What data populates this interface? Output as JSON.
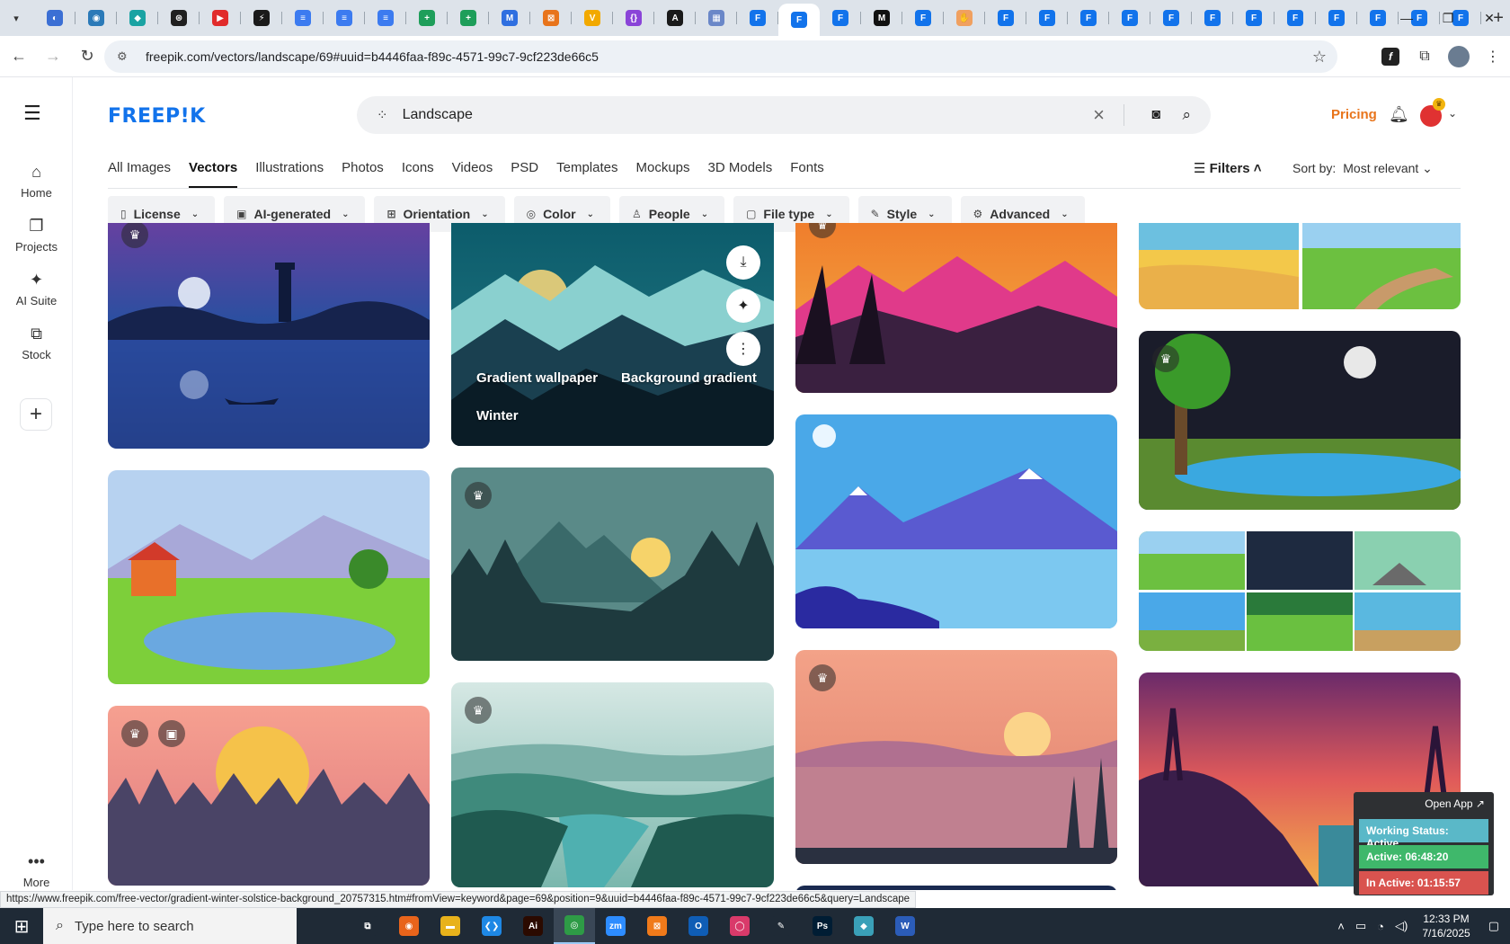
{
  "browser": {
    "tabs": [
      {
        "icon": "tab-icon-app",
        "color": "#3b6fd4",
        "glyph": "◐"
      },
      {
        "icon": "tab-icon-shield",
        "color": "#2b7ab8",
        "glyph": "◉"
      },
      {
        "icon": "tab-icon-diamond",
        "color": "#1aa3a3",
        "glyph": "◆"
      },
      {
        "icon": "tab-icon-ai",
        "color": "#202020",
        "glyph": "⊛"
      },
      {
        "icon": "tab-icon-youtube",
        "color": "#e12b2b",
        "glyph": "▶"
      },
      {
        "icon": "tab-icon-bolt",
        "color": "#1a1a1a",
        "glyph": "⚡"
      },
      {
        "icon": "tab-icon-docs",
        "color": "#3c7bf0",
        "glyph": "≡"
      },
      {
        "icon": "tab-icon-docs",
        "color": "#3c7bf0",
        "glyph": "≡"
      },
      {
        "icon": "tab-icon-docs",
        "color": "#3c7bf0",
        "glyph": "≡"
      },
      {
        "icon": "tab-icon-sheets",
        "color": "#1e9e5a",
        "glyph": "+"
      },
      {
        "icon": "tab-icon-sheets",
        "color": "#1e9e5a",
        "glyph": "+"
      },
      {
        "icon": "tab-icon-m",
        "color": "#2f6fe0",
        "glyph": "M"
      },
      {
        "icon": "tab-icon-box",
        "color": "#e8741b",
        "glyph": "⊠"
      },
      {
        "icon": "tab-icon-v",
        "color": "#f2a900",
        "glyph": "V"
      },
      {
        "icon": "tab-icon-braces",
        "color": "#8a44d8",
        "glyph": "{}"
      },
      {
        "icon": "tab-icon-a",
        "color": "#1a1a1a",
        "glyph": "A"
      },
      {
        "icon": "tab-icon-grid",
        "color": "#6a87c8",
        "glyph": "▦"
      },
      {
        "icon": "tab-icon-freepik",
        "color": "#1273eb",
        "glyph": "F"
      },
      {
        "icon": "tab-icon-freepik",
        "color": "#1273eb",
        "glyph": "F",
        "active": true
      },
      {
        "icon": "tab-icon-freepik",
        "color": "#1273eb",
        "glyph": "F"
      },
      {
        "icon": "tab-icon-m-black",
        "color": "#111111",
        "glyph": "M"
      },
      {
        "icon": "tab-icon-freepik",
        "color": "#1273eb",
        "glyph": "F"
      },
      {
        "icon": "tab-icon-hand",
        "color": "#f0a060",
        "glyph": "✋"
      },
      {
        "icon": "tab-icon-freepik",
        "color": "#1273eb",
        "glyph": "F"
      },
      {
        "icon": "tab-icon-freepik",
        "color": "#1273eb",
        "glyph": "F"
      },
      {
        "icon": "tab-icon-freepik",
        "color": "#1273eb",
        "glyph": "F"
      },
      {
        "icon": "tab-icon-freepik",
        "color": "#1273eb",
        "glyph": "F"
      },
      {
        "icon": "tab-icon-freepik",
        "color": "#1273eb",
        "glyph": "F"
      },
      {
        "icon": "tab-icon-freepik",
        "color": "#1273eb",
        "glyph": "F"
      },
      {
        "icon": "tab-icon-freepik",
        "color": "#1273eb",
        "glyph": "F"
      },
      {
        "icon": "tab-icon-freepik",
        "color": "#1273eb",
        "glyph": "F"
      },
      {
        "icon": "tab-icon-freepik",
        "color": "#1273eb",
        "glyph": "F"
      },
      {
        "icon": "tab-icon-freepik",
        "color": "#1273eb",
        "glyph": "F"
      },
      {
        "icon": "tab-icon-freepik",
        "color": "#1273eb",
        "glyph": "F"
      },
      {
        "icon": "tab-icon-freepik",
        "color": "#1273eb",
        "glyph": "F"
      }
    ],
    "url": "freepik.com/vectors/landscape/69#uuid=b4446faa-f89c-4571-99c7-9cf223de66c5",
    "status_link": "https://www.freepik.com/free-vector/gradient-winter-solstice-background_20757315.htm#fromView=keyword&page=69&position=9&uuid=b4446faa-f89c-4571-99c7-9cf223de66c5&query=Landscape"
  },
  "rail": {
    "items": [
      {
        "label": "Home",
        "icon": "home-icon",
        "glyph": "⌂"
      },
      {
        "label": "Projects",
        "icon": "projects-icon",
        "glyph": "❐"
      },
      {
        "label": "AI Suite",
        "icon": "ai-suite-icon",
        "glyph": "✦"
      },
      {
        "label": "Stock",
        "icon": "stock-icon",
        "glyph": "⧉"
      }
    ],
    "more_label": "More"
  },
  "header": {
    "logo": "FREEP!K",
    "search_query": "Landscape",
    "pricing": "Pricing"
  },
  "categories": [
    {
      "label": "All Images",
      "active": false
    },
    {
      "label": "Vectors",
      "active": true
    },
    {
      "label": "Illustrations",
      "active": false
    },
    {
      "label": "Photos",
      "active": false
    },
    {
      "label": "Icons",
      "active": false
    },
    {
      "label": "Videos",
      "active": false
    },
    {
      "label": "PSD",
      "active": false
    },
    {
      "label": "Templates",
      "active": false
    },
    {
      "label": "Mockups",
      "active": false
    },
    {
      "label": "3D Models",
      "active": false
    },
    {
      "label": "Fonts",
      "active": false
    }
  ],
  "sort": {
    "filters_label": "Filters",
    "sort_label": "Sort by:",
    "sort_value": "Most relevant"
  },
  "chips": [
    {
      "label": "License",
      "icon": "license-icon",
      "glyph": "▯"
    },
    {
      "label": "AI-generated",
      "icon": "ai-generated-icon",
      "glyph": "▣"
    },
    {
      "label": "Orientation",
      "icon": "orientation-icon",
      "glyph": "⊞"
    },
    {
      "label": "Color",
      "icon": "palette-icon",
      "glyph": "◎"
    },
    {
      "label": "People",
      "icon": "people-icon",
      "glyph": "♙"
    },
    {
      "label": "File type",
      "icon": "file-icon",
      "glyph": "▢"
    },
    {
      "label": "Style",
      "icon": "brush-icon",
      "glyph": "✎"
    },
    {
      "label": "Advanced",
      "icon": "gear-icon",
      "glyph": "⚙"
    }
  ],
  "hovered_card": {
    "tags": [
      "Gradient wallpaper",
      "Background gradient",
      "Winter"
    ]
  },
  "widget": {
    "open_app": "Open App ↗",
    "status": "Working Status: Active",
    "active": "Active: 06:48:20",
    "inactive": "In Active: 01:15:57",
    "colors": {
      "status": "#5ab8c8",
      "active": "#3fb86b",
      "inactive": "#d9534f"
    }
  },
  "taskbar": {
    "search_placeholder": "Type here to search",
    "time": "12:33 PM",
    "date": "7/16/2025",
    "apps": [
      {
        "icon": "task-view-icon",
        "color": "#1f2a36",
        "glyph": "⧉"
      },
      {
        "icon": "firefox-icon",
        "color": "#e8641b",
        "glyph": "◉"
      },
      {
        "icon": "file-explorer-icon",
        "color": "#e8b21b",
        "glyph": "▬"
      },
      {
        "icon": "vscode-icon",
        "color": "#1e88e5",
        "glyph": "❮❯"
      },
      {
        "icon": "illustrator-icon",
        "color": "#2b0a00",
        "glyph": "Ai"
      },
      {
        "icon": "chrome-icon",
        "color": "#2e9b46",
        "glyph": "◎",
        "active": true
      },
      {
        "icon": "zoom-icon",
        "color": "#2d8cff",
        "glyph": "zm"
      },
      {
        "icon": "xampp-icon",
        "color": "#f07a1a",
        "glyph": "⊠"
      },
      {
        "icon": "outlook-icon",
        "color": "#0f5db5",
        "glyph": "O"
      },
      {
        "icon": "creative-cloud-icon",
        "color": "#d93a6a",
        "glyph": "◯"
      },
      {
        "icon": "pen-icon",
        "color": "#1f2a36",
        "glyph": "✎"
      },
      {
        "icon": "photoshop-icon",
        "color": "#001d34",
        "glyph": "Ps"
      },
      {
        "icon": "diamond-app-icon",
        "color": "#3aa0b8",
        "glyph": "◆"
      },
      {
        "icon": "word-icon",
        "color": "#2b5cb8",
        "glyph": "W"
      }
    ]
  }
}
